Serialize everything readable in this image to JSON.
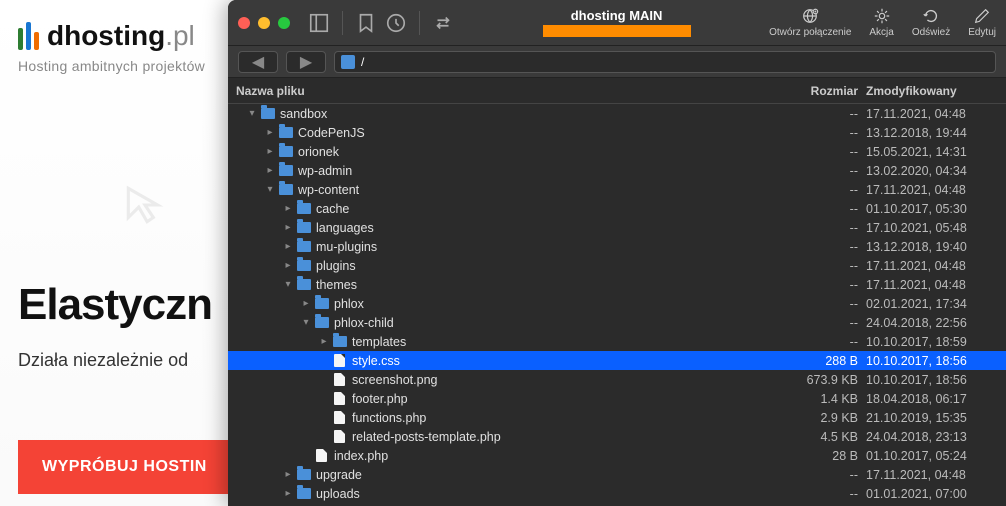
{
  "website": {
    "logo": "dhosting",
    "logo_suffix": ".pl",
    "tagline": "Hosting ambitnych projektów",
    "headline": "Elastyczn",
    "subhead": "Działa niezależnie od",
    "cta": "WYPRÓBUJ HOSTIN"
  },
  "ftp": {
    "connection_name": "dhosting MAIN",
    "path": "/",
    "toolbar": {
      "open_connection": "Otwórz połączenie",
      "action": "Akcja",
      "refresh": "Odśwież",
      "edit": "Edytuj"
    },
    "columns": {
      "name": "Nazwa pliku",
      "size": "Rozmiar",
      "modified": "Zmodyfikowany"
    },
    "files": [
      {
        "depth": 0,
        "chev": "down",
        "type": "folder",
        "name": "sandbox",
        "size": "--",
        "date": "17.11.2021, 04:48",
        "sel": false
      },
      {
        "depth": 1,
        "chev": "right",
        "type": "folder",
        "name": "CodePenJS",
        "size": "--",
        "date": "13.12.2018, 19:44",
        "sel": false
      },
      {
        "depth": 1,
        "chev": "right",
        "type": "folder",
        "name": "orionek",
        "size": "--",
        "date": "15.05.2021, 14:31",
        "sel": false
      },
      {
        "depth": 1,
        "chev": "right",
        "type": "folder",
        "name": "wp-admin",
        "size": "--",
        "date": "13.02.2020, 04:34",
        "sel": false
      },
      {
        "depth": 1,
        "chev": "down",
        "type": "folder",
        "name": "wp-content",
        "size": "--",
        "date": "17.11.2021, 04:48",
        "sel": false
      },
      {
        "depth": 2,
        "chev": "right",
        "type": "folder",
        "name": "cache",
        "size": "--",
        "date": "01.10.2017, 05:30",
        "sel": false
      },
      {
        "depth": 2,
        "chev": "right",
        "type": "folder",
        "name": "languages",
        "size": "--",
        "date": "17.10.2021, 05:48",
        "sel": false
      },
      {
        "depth": 2,
        "chev": "right",
        "type": "folder",
        "name": "mu-plugins",
        "size": "--",
        "date": "13.12.2018, 19:40",
        "sel": false
      },
      {
        "depth": 2,
        "chev": "right",
        "type": "folder",
        "name": "plugins",
        "size": "--",
        "date": "17.11.2021, 04:48",
        "sel": false
      },
      {
        "depth": 2,
        "chev": "down",
        "type": "folder",
        "name": "themes",
        "size": "--",
        "date": "17.11.2021, 04:48",
        "sel": false
      },
      {
        "depth": 3,
        "chev": "right",
        "type": "folder",
        "name": "phlox",
        "size": "--",
        "date": "02.01.2021, 17:34",
        "sel": false
      },
      {
        "depth": 3,
        "chev": "down",
        "type": "folder",
        "name": "phlox-child",
        "size": "--",
        "date": "24.04.2018, 22:56",
        "sel": false
      },
      {
        "depth": 4,
        "chev": "right",
        "type": "folder",
        "name": "templates",
        "size": "--",
        "date": "10.10.2017, 18:59",
        "sel": false
      },
      {
        "depth": 4,
        "chev": "",
        "type": "file",
        "name": "style.css",
        "size": "288 B",
        "date": "10.10.2017, 18:56",
        "sel": true
      },
      {
        "depth": 4,
        "chev": "",
        "type": "file",
        "name": "screenshot.png",
        "size": "673.9 KB",
        "date": "10.10.2017, 18:56",
        "sel": false
      },
      {
        "depth": 4,
        "chev": "",
        "type": "file",
        "name": "footer.php",
        "size": "1.4 KB",
        "date": "18.04.2018, 06:17",
        "sel": false
      },
      {
        "depth": 4,
        "chev": "",
        "type": "file",
        "name": "functions.php",
        "size": "2.9 KB",
        "date": "21.10.2019, 15:35",
        "sel": false
      },
      {
        "depth": 4,
        "chev": "",
        "type": "file",
        "name": "related-posts-template.php",
        "size": "4.5 KB",
        "date": "24.04.2018, 23:13",
        "sel": false
      },
      {
        "depth": 3,
        "chev": "",
        "type": "file",
        "name": "index.php",
        "size": "28 B",
        "date": "01.10.2017, 05:24",
        "sel": false
      },
      {
        "depth": 2,
        "chev": "right",
        "type": "folder",
        "name": "upgrade",
        "size": "--",
        "date": "17.11.2021, 04:48",
        "sel": false
      },
      {
        "depth": 2,
        "chev": "right",
        "type": "folder",
        "name": "uploads",
        "size": "--",
        "date": "01.01.2021, 07:00",
        "sel": false
      }
    ]
  }
}
